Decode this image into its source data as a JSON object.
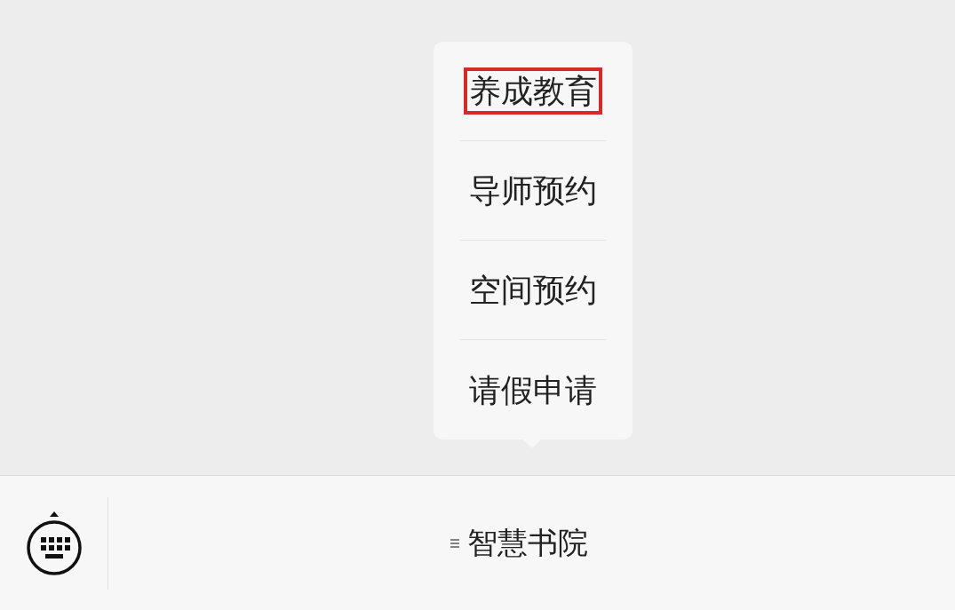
{
  "submenu": [
    {
      "label": "养成教育",
      "highlighted": true
    },
    {
      "label": "导师预约",
      "highlighted": false
    },
    {
      "label": "空间预约",
      "highlighted": false
    },
    {
      "label": "请假申请",
      "highlighted": false
    }
  ],
  "bottom_bar": {
    "menu_label": "智慧书院"
  }
}
